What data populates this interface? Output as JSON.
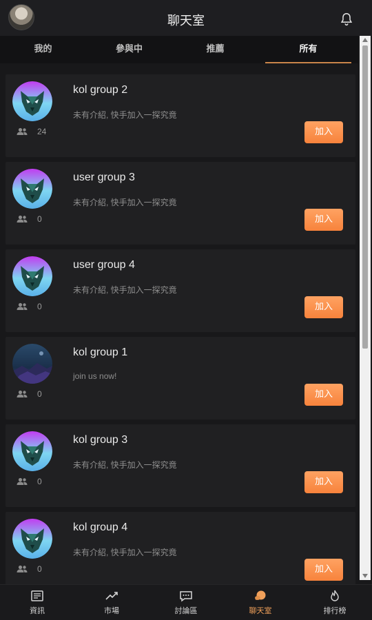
{
  "header": {
    "title": "聊天室",
    "avatar_icon": "user-avatar",
    "bell_icon": "bell-icon"
  },
  "tabs": [
    {
      "label": "我的",
      "active": false
    },
    {
      "label": "參與中",
      "active": false
    },
    {
      "label": "推薦",
      "active": false
    },
    {
      "label": "所有",
      "active": true
    }
  ],
  "groups": [
    {
      "name": "kol group 2",
      "desc": "未有介紹, 快手加入一探究竟",
      "members": "24",
      "join": "加入",
      "avatar": "wolf"
    },
    {
      "name": "user group 3",
      "desc": "未有介紹, 快手加入一探究竟",
      "members": "0",
      "join": "加入",
      "avatar": "wolf"
    },
    {
      "name": "user group 4",
      "desc": "未有介紹, 快手加入一探究竟",
      "members": "0",
      "join": "加入",
      "avatar": "wolf"
    },
    {
      "name": "kol group 1",
      "desc": "join us now!",
      "members": "0",
      "join": "加入",
      "avatar": "landscape"
    },
    {
      "name": "kol group 3",
      "desc": "未有介紹, 快手加入一探究竟",
      "members": "0",
      "join": "加入",
      "avatar": "wolf"
    },
    {
      "name": "kol group 4",
      "desc": "未有介紹, 快手加入一探究竟",
      "members": "0",
      "join": "加入",
      "avatar": "wolf"
    }
  ],
  "bottom_nav": [
    {
      "label": "資訊",
      "icon": "news-icon",
      "active": false
    },
    {
      "label": "市場",
      "icon": "market-icon",
      "active": false
    },
    {
      "label": "討論區",
      "icon": "discussion-icon",
      "active": false
    },
    {
      "label": "聊天室",
      "icon": "chat-icon",
      "active": true
    },
    {
      "label": "排行榜",
      "icon": "ranking-icon",
      "active": false
    }
  ],
  "colors": {
    "accent": "#f7833c",
    "background": "#18181a",
    "card": "#202022"
  }
}
